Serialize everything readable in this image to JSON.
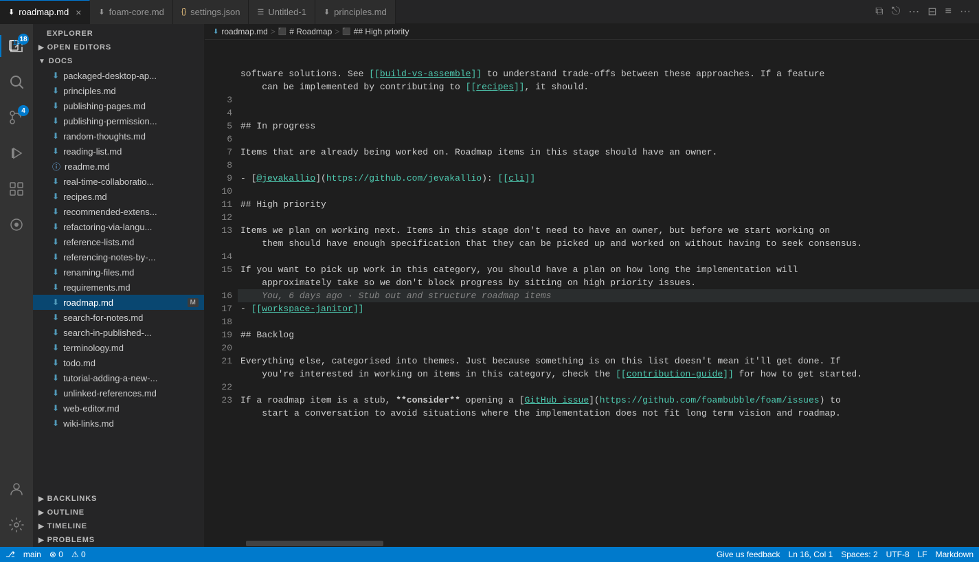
{
  "tabs": [
    {
      "id": "roadmap",
      "label": "roadmap.md",
      "icon": "📝",
      "active": true,
      "closeable": true,
      "modified": false
    },
    {
      "id": "foam-core",
      "label": "foam-core.md",
      "icon": "📝",
      "active": false,
      "closeable": false
    },
    {
      "id": "settings",
      "label": "settings.json",
      "icon": "{}",
      "active": false,
      "closeable": false
    },
    {
      "id": "untitled",
      "label": "Untitled-1",
      "icon": "☰",
      "active": false,
      "closeable": false
    },
    {
      "id": "principles",
      "label": "principles.md",
      "icon": "⬇",
      "active": false,
      "closeable": false
    }
  ],
  "breadcrumb": {
    "items": [
      "roadmap.md",
      "# Roadmap",
      "## High priority"
    ]
  },
  "activity_bar": {
    "icons": [
      {
        "name": "explorer",
        "label": "Explorer",
        "glyph": "📁",
        "active": true,
        "badge": "18"
      },
      {
        "name": "search",
        "label": "Search",
        "glyph": "🔍",
        "active": false
      },
      {
        "name": "source-control",
        "label": "Source Control",
        "glyph": "⎇",
        "active": false,
        "badge": "4"
      },
      {
        "name": "run",
        "label": "Run",
        "glyph": "▶",
        "active": false
      },
      {
        "name": "extensions",
        "label": "Extensions",
        "glyph": "⊞",
        "active": false
      },
      {
        "name": "foam",
        "label": "Foam",
        "glyph": "◉",
        "active": false
      }
    ],
    "bottom_icons": [
      {
        "name": "accounts",
        "glyph": "👤"
      },
      {
        "name": "settings",
        "glyph": "⚙"
      }
    ]
  },
  "sidebar": {
    "header": "Explorer",
    "open_editors_label": "Open Editors",
    "docs_label": "Docs",
    "files": [
      {
        "name": "packaged-desktop-ap...",
        "type": "md",
        "active": false
      },
      {
        "name": "principles.md",
        "type": "md",
        "active": false
      },
      {
        "name": "publishing-pages.md",
        "type": "md",
        "active": false
      },
      {
        "name": "publishing-permission...",
        "type": "md",
        "active": false
      },
      {
        "name": "random-thoughts.md",
        "type": "md",
        "active": false
      },
      {
        "name": "reading-list.md",
        "type": "md",
        "active": false
      },
      {
        "name": "readme.md",
        "type": "md-info",
        "active": false
      },
      {
        "name": "real-time-collaboratio...",
        "type": "md",
        "active": false
      },
      {
        "name": "recipes.md",
        "type": "md",
        "active": false
      },
      {
        "name": "recommended-extens...",
        "type": "md",
        "active": false
      },
      {
        "name": "refactoring-via-langu...",
        "type": "md",
        "active": false
      },
      {
        "name": "reference-lists.md",
        "type": "md",
        "active": false
      },
      {
        "name": "referencing-notes-by-...",
        "type": "md",
        "active": false
      },
      {
        "name": "renaming-files.md",
        "type": "md",
        "active": false
      },
      {
        "name": "requirements.md",
        "type": "md",
        "active": false
      },
      {
        "name": "roadmap.md",
        "type": "md",
        "active": true,
        "badge": "M"
      },
      {
        "name": "search-for-notes.md",
        "type": "md",
        "active": false
      },
      {
        "name": "search-in-published-...",
        "type": "md",
        "active": false
      },
      {
        "name": "terminology.md",
        "type": "md",
        "active": false
      },
      {
        "name": "todo.md",
        "type": "md",
        "active": false
      },
      {
        "name": "tutorial-adding-a-new-...",
        "type": "md",
        "active": false
      },
      {
        "name": "unlinked-references.md",
        "type": "md",
        "active": false
      },
      {
        "name": "web-editor.md",
        "type": "md",
        "active": false
      },
      {
        "name": "wiki-links.md",
        "type": "md",
        "active": false
      }
    ],
    "bottom_sections": [
      {
        "name": "Backlinks",
        "id": "backlinks"
      },
      {
        "name": "Outline",
        "id": "outline"
      },
      {
        "name": "Timeline",
        "id": "timeline"
      },
      {
        "name": "Problems",
        "id": "problems"
      }
    ]
  },
  "editor": {
    "lines": [
      {
        "num": "",
        "content_type": "text",
        "text": ""
      },
      {
        "num": "",
        "content_type": "text",
        "text": ""
      },
      {
        "num": "",
        "content_type": "wrapped",
        "text": "software solutions. See [[build-vs-assemble]] to understand trade-offs between these approaches. If a feature"
      },
      {
        "num": "",
        "content_type": "wrapped-indent",
        "text": "can be implemented by contributing to [[recipes]], it should."
      },
      {
        "num": "3",
        "content_type": "empty"
      },
      {
        "num": "4",
        "content_type": "empty"
      },
      {
        "num": "5",
        "content_type": "heading2",
        "text": "## In progress"
      },
      {
        "num": "6",
        "content_type": "empty"
      },
      {
        "num": "7",
        "content_type": "text",
        "text": "Items that are already being worked on. Roadmap items in this stage should have an owner."
      },
      {
        "num": "8",
        "content_type": "empty"
      },
      {
        "num": "9",
        "content_type": "list-link",
        "text": "- [@jevakallio](https://github.com/jevakallio): [[cli]]"
      },
      {
        "num": "10",
        "content_type": "empty"
      },
      {
        "num": "11",
        "content_type": "heading2",
        "text": "## High priority"
      },
      {
        "num": "12",
        "content_type": "empty"
      },
      {
        "num": "13",
        "content_type": "text-long",
        "text": "Items we plan on working next. Items in this stage don't need to have an owner, but before we start working on"
      },
      {
        "num": "",
        "content_type": "wrapped-indent",
        "text": "them should have enough specification that they can be picked up and worked on without having to seek consensus."
      },
      {
        "num": "14",
        "content_type": "empty"
      },
      {
        "num": "15",
        "content_type": "text-long",
        "text": "If you want to pick up work in this category, you should have a plan on how long the implementation will"
      },
      {
        "num": "",
        "content_type": "wrapped-indent",
        "text": "approximately take so we don't block progress by sitting on high priority issues."
      },
      {
        "num": "16",
        "content_type": "git-blame",
        "text": "    You, 6 days ago · Stub out and structure roadmap items",
        "highlighted": true
      },
      {
        "num": "17",
        "content_type": "list-link2",
        "text": "- [[workspace-janitor]]"
      },
      {
        "num": "18",
        "content_type": "empty"
      },
      {
        "num": "19",
        "content_type": "heading2",
        "text": "## Backlog"
      },
      {
        "num": "20",
        "content_type": "empty"
      },
      {
        "num": "21",
        "content_type": "text-long",
        "text": "Everything else, categorised into themes. Just because something is on this list doesn't mean it'll get done. If"
      },
      {
        "num": "",
        "content_type": "wrapped-indent",
        "text": "you're interested in working on items in this category, check the [[contribution-guide]] for how to get started."
      },
      {
        "num": "22",
        "content_type": "empty"
      },
      {
        "num": "23",
        "content_type": "text-code",
        "text": "If a roadmap item is a stub, **consider** opening a [GitHub issue](https://github.com/foambubble/foam/issues) to"
      },
      {
        "num": "",
        "content_type": "wrapped-indent",
        "text": "start a conversation to avoid situations where the implementation does not fit long term vision and roadmap."
      }
    ]
  },
  "status_bar": {
    "branch": "main",
    "errors": "0",
    "warnings": "0",
    "ln": "Ln 16, Col 1",
    "spaces": "Spaces: 2",
    "encoding": "UTF-8",
    "eol": "LF",
    "language": "Markdown",
    "feedback": "Give us feedback"
  }
}
